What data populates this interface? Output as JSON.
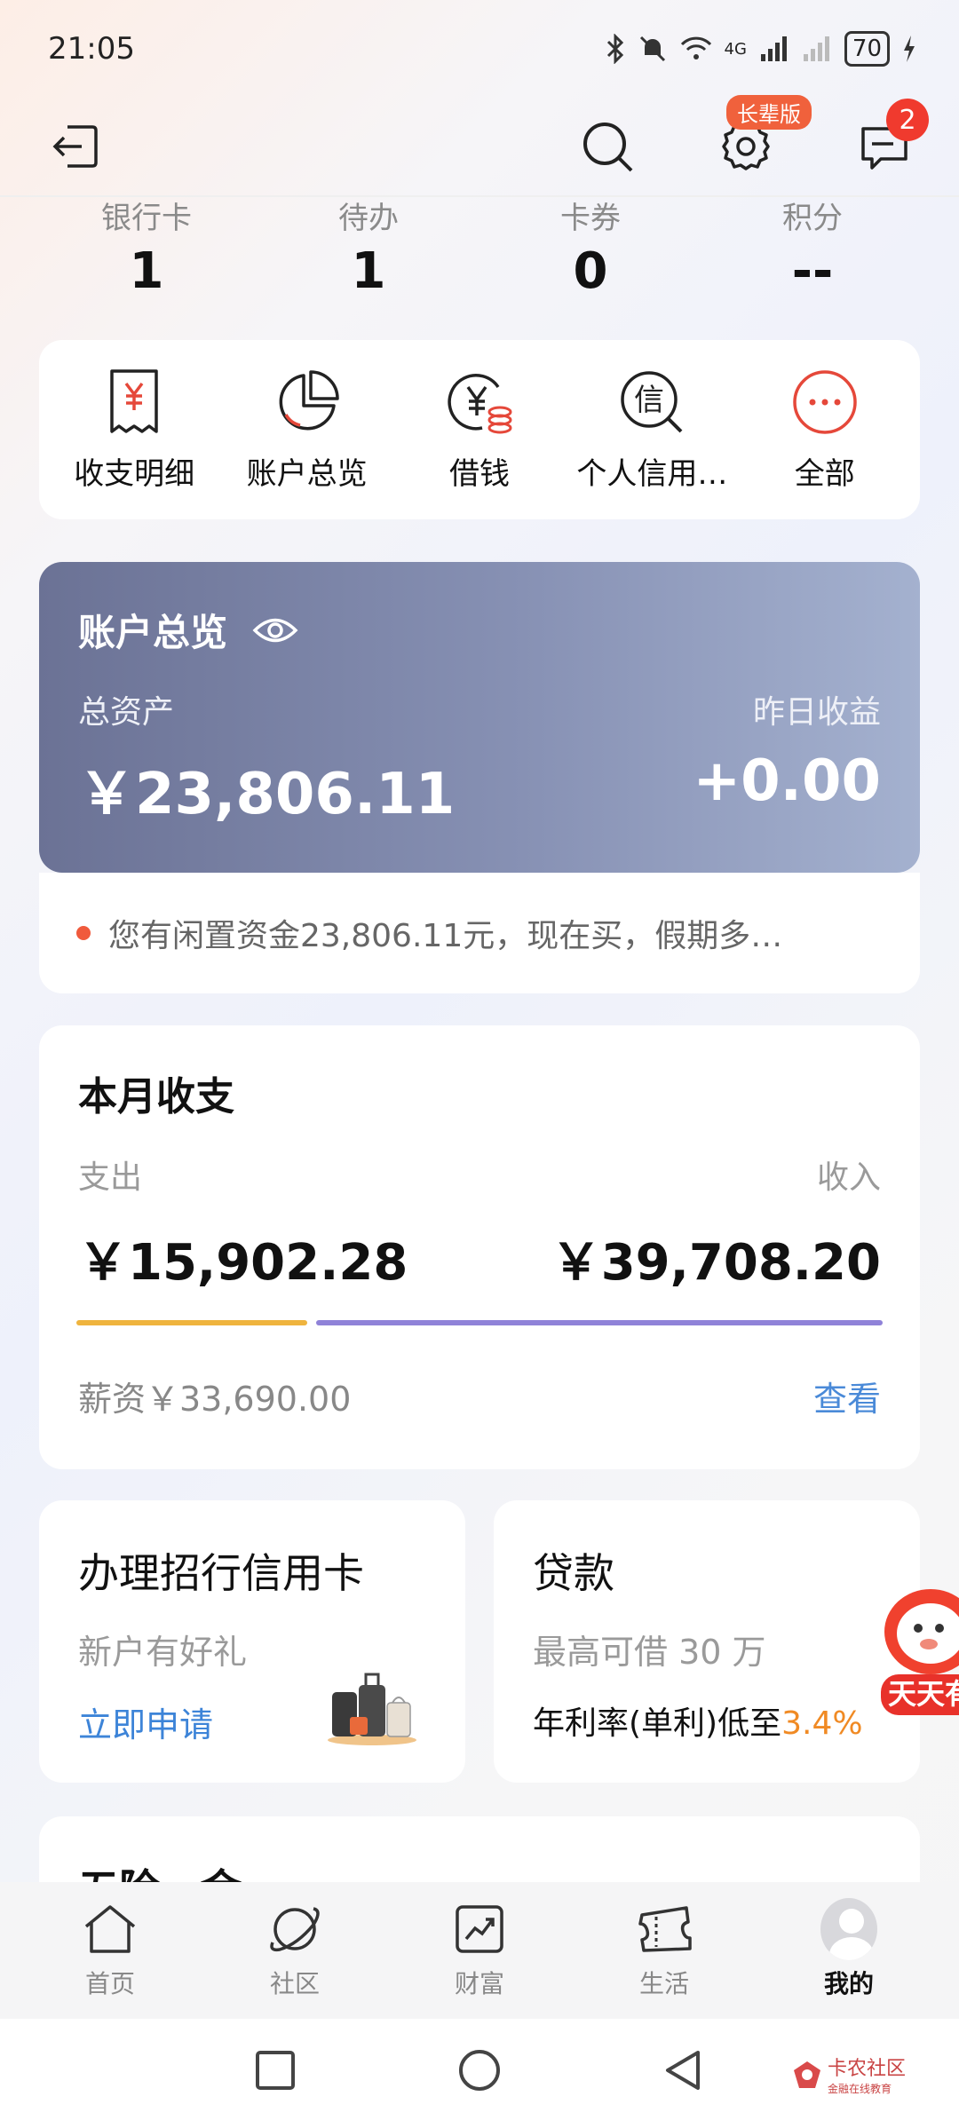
{
  "status_bar": {
    "time": "21:05",
    "battery": "70",
    "network": "4G"
  },
  "header": {
    "senior_badge": "长辈版",
    "message_count": "2"
  },
  "stats": [
    {
      "label": "银行卡",
      "value": "1"
    },
    {
      "label": "待办",
      "value": "1"
    },
    {
      "label": "卡券",
      "value": "0"
    },
    {
      "label": "积分",
      "value": "--"
    }
  ],
  "quick_actions": [
    {
      "label": "收支明细",
      "icon": "receipt-yen-icon"
    },
    {
      "label": "账户总览",
      "icon": "pie-chart-icon"
    },
    {
      "label": "借钱",
      "icon": "yen-coin-icon"
    },
    {
      "label": "个人信用…",
      "icon": "credit-search-icon"
    },
    {
      "label": "全部",
      "icon": "more-dots-icon"
    }
  ],
  "asset_overview": {
    "title": "账户总览",
    "total_label": "总资产",
    "total_value": "￥23,806.11",
    "yesterday_label": "昨日收益",
    "yesterday_value": "+0.00",
    "gradient_start": "#6b7295",
    "gradient_end": "#a4b1cf"
  },
  "notice": {
    "text": "您有闲置资金23,806.11元，现在买，假期多…"
  },
  "monthly": {
    "title": "本月收支",
    "expense_label": "支出",
    "income_label": "收入",
    "expense_value": "￥15,902.28",
    "income_value": "￥39,708.20",
    "expense_ratio": 0.286,
    "expense_color": "#efb43e",
    "income_color": "#8f82d8",
    "salary_text": "薪资￥33,690.00",
    "view_label": "查看"
  },
  "promos": {
    "credit_card": {
      "title": "办理招行信用卡",
      "subtitle": "新户有好礼",
      "link": "立即申请"
    },
    "loan": {
      "title": "贷款",
      "subtitle": "最高可借 30 万",
      "rate_prefix": "年利率(单利)低至",
      "rate_value": "3.4%"
    }
  },
  "next_section": {
    "title": "五险一金"
  },
  "tabs": [
    {
      "label": "首页",
      "icon": "home-icon"
    },
    {
      "label": "社区",
      "icon": "planet-icon"
    },
    {
      "label": "财富",
      "icon": "wealth-chart-icon"
    },
    {
      "label": "生活",
      "icon": "ticket-icon"
    },
    {
      "label": "我的",
      "icon": "avatar-icon",
      "active": true
    }
  ],
  "watermark": {
    "text": "卡农社区",
    "sub": "金融在线教育"
  }
}
